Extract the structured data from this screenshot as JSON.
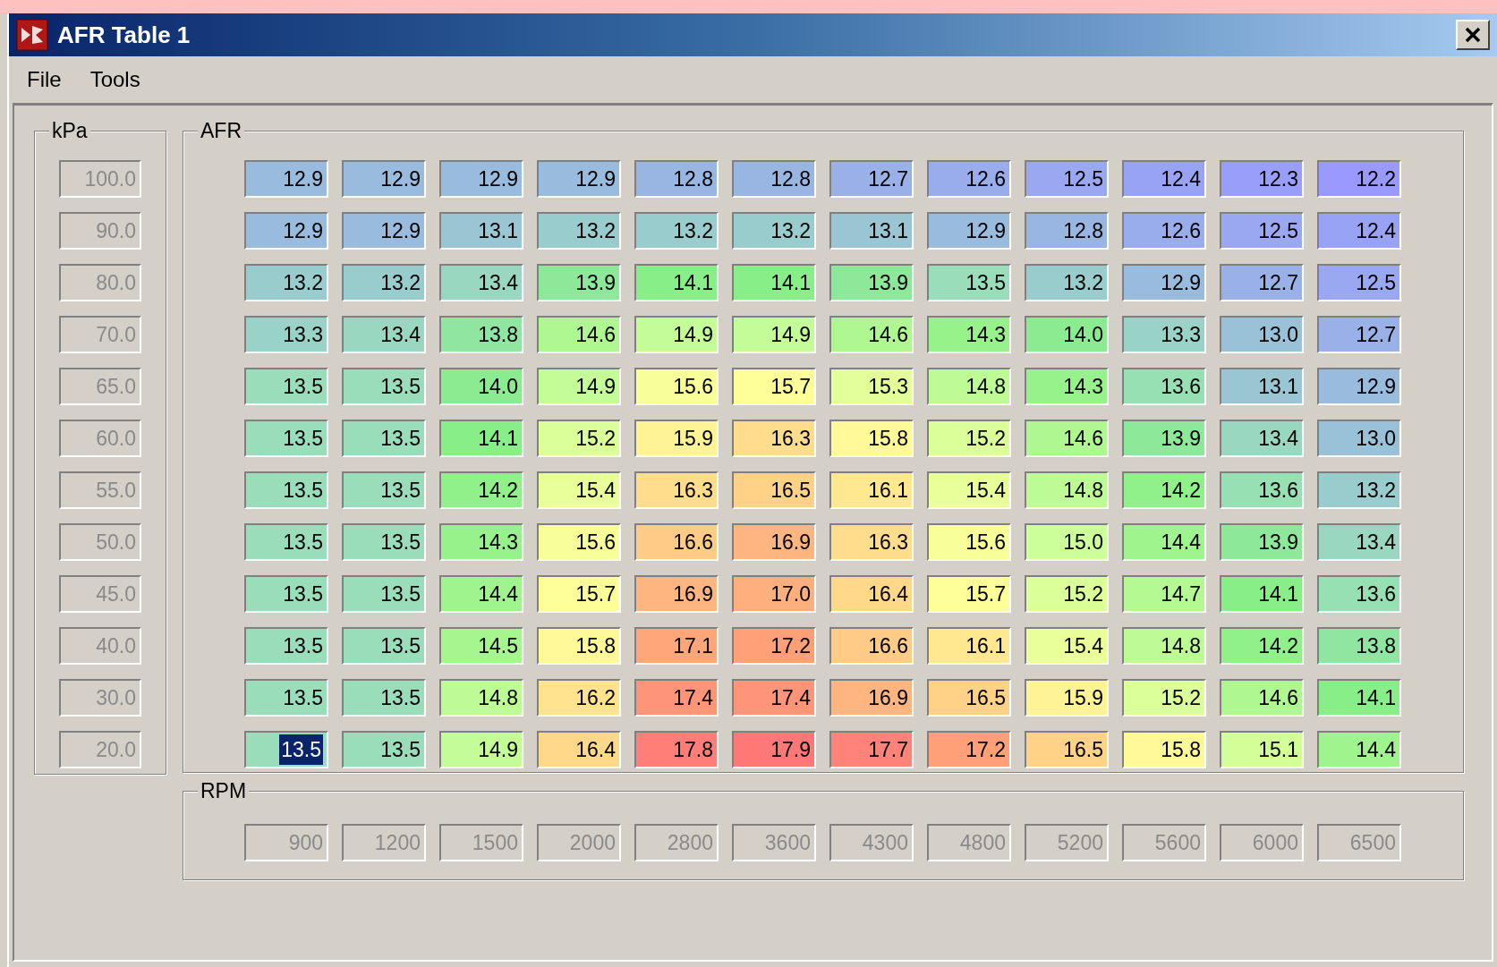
{
  "window": {
    "title": "AFR Table 1"
  },
  "menu": [
    "File",
    "Tools"
  ],
  "kpa": {
    "label": "kPa",
    "disabled": true,
    "values": [
      "100.0",
      "90.0",
      "80.0",
      "70.0",
      "65.0",
      "60.0",
      "55.0",
      "50.0",
      "45.0",
      "40.0",
      "30.0",
      "20.0"
    ]
  },
  "afr": {
    "label": "AFR",
    "rows": [
      [
        {
          "value": "12.9",
          "selected": false
        },
        {
          "value": "12.9",
          "selected": false
        },
        {
          "value": "12.9",
          "selected": false
        },
        {
          "value": "12.9",
          "selected": false
        },
        {
          "value": "12.8",
          "selected": false
        },
        {
          "value": "12.8",
          "selected": false
        },
        {
          "value": "12.7",
          "selected": false
        },
        {
          "value": "12.6",
          "selected": false
        },
        {
          "value": "12.5",
          "selected": false
        },
        {
          "value": "12.4",
          "selected": false
        },
        {
          "value": "12.3",
          "selected": false
        },
        {
          "value": "12.2",
          "selected": false
        }
      ],
      [
        {
          "value": "12.9",
          "selected": false
        },
        {
          "value": "12.9",
          "selected": false
        },
        {
          "value": "13.1",
          "selected": false
        },
        {
          "value": "13.2",
          "selected": false
        },
        {
          "value": "13.2",
          "selected": false
        },
        {
          "value": "13.2",
          "selected": false
        },
        {
          "value": "13.1",
          "selected": false
        },
        {
          "value": "12.9",
          "selected": false
        },
        {
          "value": "12.8",
          "selected": false
        },
        {
          "value": "12.6",
          "selected": false
        },
        {
          "value": "12.5",
          "selected": false
        },
        {
          "value": "12.4",
          "selected": false
        }
      ],
      [
        {
          "value": "13.2",
          "selected": false
        },
        {
          "value": "13.2",
          "selected": false
        },
        {
          "value": "13.4",
          "selected": false
        },
        {
          "value": "13.9",
          "selected": false
        },
        {
          "value": "14.1",
          "selected": false
        },
        {
          "value": "14.1",
          "selected": false
        },
        {
          "value": "13.9",
          "selected": false
        },
        {
          "value": "13.5",
          "selected": false
        },
        {
          "value": "13.2",
          "selected": false
        },
        {
          "value": "12.9",
          "selected": false
        },
        {
          "value": "12.7",
          "selected": false
        },
        {
          "value": "12.5",
          "selected": false
        }
      ],
      [
        {
          "value": "13.3",
          "selected": false
        },
        {
          "value": "13.4",
          "selected": false
        },
        {
          "value": "13.8",
          "selected": false
        },
        {
          "value": "14.6",
          "selected": false
        },
        {
          "value": "14.9",
          "selected": false
        },
        {
          "value": "14.9",
          "selected": false
        },
        {
          "value": "14.6",
          "selected": false
        },
        {
          "value": "14.3",
          "selected": false
        },
        {
          "value": "14.0",
          "selected": false
        },
        {
          "value": "13.3",
          "selected": false
        },
        {
          "value": "13.0",
          "selected": false
        },
        {
          "value": "12.7",
          "selected": false
        }
      ],
      [
        {
          "value": "13.5",
          "selected": false
        },
        {
          "value": "13.5",
          "selected": false
        },
        {
          "value": "14.0",
          "selected": false
        },
        {
          "value": "14.9",
          "selected": false
        },
        {
          "value": "15.6",
          "selected": false
        },
        {
          "value": "15.7",
          "selected": false
        },
        {
          "value": "15.3",
          "selected": false
        },
        {
          "value": "14.8",
          "selected": false
        },
        {
          "value": "14.3",
          "selected": false
        },
        {
          "value": "13.6",
          "selected": false
        },
        {
          "value": "13.1",
          "selected": false
        },
        {
          "value": "12.9",
          "selected": false
        }
      ],
      [
        {
          "value": "13.5",
          "selected": false
        },
        {
          "value": "13.5",
          "selected": false
        },
        {
          "value": "14.1",
          "selected": false
        },
        {
          "value": "15.2",
          "selected": false
        },
        {
          "value": "15.9",
          "selected": false
        },
        {
          "value": "16.3",
          "selected": false
        },
        {
          "value": "15.8",
          "selected": false
        },
        {
          "value": "15.2",
          "selected": false
        },
        {
          "value": "14.6",
          "selected": false
        },
        {
          "value": "13.9",
          "selected": false
        },
        {
          "value": "13.4",
          "selected": false
        },
        {
          "value": "13.0",
          "selected": false
        }
      ],
      [
        {
          "value": "13.5",
          "selected": false
        },
        {
          "value": "13.5",
          "selected": false
        },
        {
          "value": "14.2",
          "selected": false
        },
        {
          "value": "15.4",
          "selected": false
        },
        {
          "value": "16.3",
          "selected": false
        },
        {
          "value": "16.5",
          "selected": false
        },
        {
          "value": "16.1",
          "selected": false
        },
        {
          "value": "15.4",
          "selected": false
        },
        {
          "value": "14.8",
          "selected": false
        },
        {
          "value": "14.2",
          "selected": false
        },
        {
          "value": "13.6",
          "selected": false
        },
        {
          "value": "13.2",
          "selected": false
        }
      ],
      [
        {
          "value": "13.5",
          "selected": false
        },
        {
          "value": "13.5",
          "selected": false
        },
        {
          "value": "14.3",
          "selected": false
        },
        {
          "value": "15.6",
          "selected": false
        },
        {
          "value": "16.6",
          "selected": false
        },
        {
          "value": "16.9",
          "selected": false
        },
        {
          "value": "16.3",
          "selected": false
        },
        {
          "value": "15.6",
          "selected": false
        },
        {
          "value": "15.0",
          "selected": false
        },
        {
          "value": "14.4",
          "selected": false
        },
        {
          "value": "13.9",
          "selected": false
        },
        {
          "value": "13.4",
          "selected": false
        }
      ],
      [
        {
          "value": "13.5",
          "selected": false
        },
        {
          "value": "13.5",
          "selected": false
        },
        {
          "value": "14.4",
          "selected": false
        },
        {
          "value": "15.7",
          "selected": false
        },
        {
          "value": "16.9",
          "selected": false
        },
        {
          "value": "17.0",
          "selected": false
        },
        {
          "value": "16.4",
          "selected": false
        },
        {
          "value": "15.7",
          "selected": false
        },
        {
          "value": "15.2",
          "selected": false
        },
        {
          "value": "14.7",
          "selected": false
        },
        {
          "value": "14.1",
          "selected": false
        },
        {
          "value": "13.6",
          "selected": false
        }
      ],
      [
        {
          "value": "13.5",
          "selected": false
        },
        {
          "value": "13.5",
          "selected": false
        },
        {
          "value": "14.5",
          "selected": false
        },
        {
          "value": "15.8",
          "selected": false
        },
        {
          "value": "17.1",
          "selected": false
        },
        {
          "value": "17.2",
          "selected": false
        },
        {
          "value": "16.6",
          "selected": false
        },
        {
          "value": "16.1",
          "selected": false
        },
        {
          "value": "15.4",
          "selected": false
        },
        {
          "value": "14.8",
          "selected": false
        },
        {
          "value": "14.2",
          "selected": false
        },
        {
          "value": "13.8",
          "selected": false
        }
      ],
      [
        {
          "value": "13.5",
          "selected": false
        },
        {
          "value": "13.5",
          "selected": false
        },
        {
          "value": "14.8",
          "selected": false
        },
        {
          "value": "16.2",
          "selected": false
        },
        {
          "value": "17.4",
          "selected": false
        },
        {
          "value": "17.4",
          "selected": false
        },
        {
          "value": "16.9",
          "selected": false
        },
        {
          "value": "16.5",
          "selected": false
        },
        {
          "value": "15.9",
          "selected": false
        },
        {
          "value": "15.2",
          "selected": false
        },
        {
          "value": "14.6",
          "selected": false
        },
        {
          "value": "14.1",
          "selected": false
        }
      ],
      [
        {
          "value": "13.5",
          "selected": true
        },
        {
          "value": "13.5",
          "selected": false
        },
        {
          "value": "14.9",
          "selected": false
        },
        {
          "value": "16.4",
          "selected": false
        },
        {
          "value": "17.8",
          "selected": false
        },
        {
          "value": "17.9",
          "selected": false
        },
        {
          "value": "17.7",
          "selected": false
        },
        {
          "value": "17.2",
          "selected": false
        },
        {
          "value": "16.5",
          "selected": false
        },
        {
          "value": "15.8",
          "selected": false
        },
        {
          "value": "15.1",
          "selected": false
        },
        {
          "value": "14.4",
          "selected": false
        }
      ]
    ]
  },
  "rpm": {
    "label": "RPM",
    "disabled": true,
    "values": [
      "900",
      "1200",
      "1500",
      "2000",
      "2800",
      "3600",
      "4300",
      "4800",
      "5200",
      "5600",
      "6000",
      "6500"
    ]
  }
}
